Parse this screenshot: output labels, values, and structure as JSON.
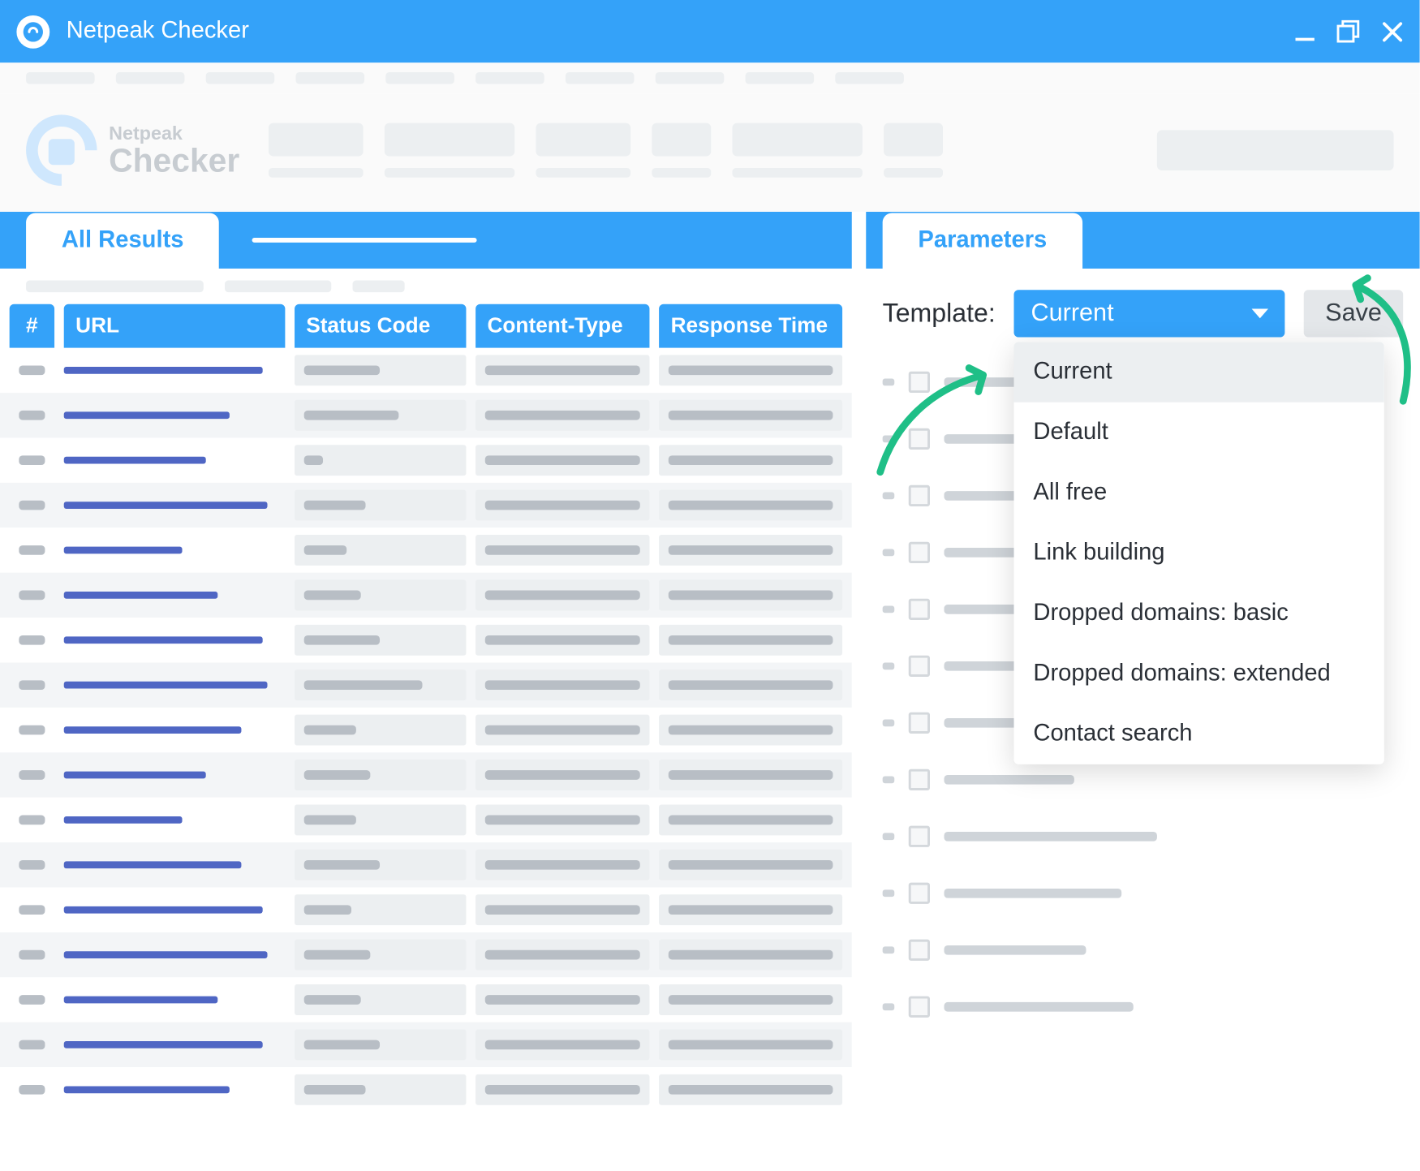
{
  "titlebar": {
    "app_name": "Netpeak Checker"
  },
  "logo": {
    "line1": "Netpeak",
    "line2": "Checker"
  },
  "tabs": {
    "all_results": "All Results",
    "parameters": "Parameters"
  },
  "table": {
    "headers": {
      "num": "#",
      "url": "URL",
      "status": "Status Code",
      "content_type": "Content-Type",
      "response_time": "Response Time"
    },
    "rows": [
      {
        "url_w": 168,
        "sc_w": 64
      },
      {
        "url_w": 140,
        "sc_w": 80
      },
      {
        "url_w": 120,
        "sc_w": 16
      },
      {
        "url_w": 172,
        "sc_w": 52
      },
      {
        "url_w": 100,
        "sc_w": 36
      },
      {
        "url_w": 130,
        "sc_w": 48
      },
      {
        "url_w": 168,
        "sc_w": 64
      },
      {
        "url_w": 172,
        "sc_w": 100
      },
      {
        "url_w": 150,
        "sc_w": 44
      },
      {
        "url_w": 120,
        "sc_w": 56
      },
      {
        "url_w": 100,
        "sc_w": 44
      },
      {
        "url_w": 150,
        "sc_w": 64
      },
      {
        "url_w": 168,
        "sc_w": 40
      },
      {
        "url_w": 172,
        "sc_w": 56
      },
      {
        "url_w": 130,
        "sc_w": 48
      },
      {
        "url_w": 168,
        "sc_w": 64
      },
      {
        "url_w": 140,
        "sc_w": 52
      }
    ]
  },
  "right": {
    "template_label": "Template:",
    "selected": "Current",
    "save": "Save",
    "options": [
      "Current",
      "Default",
      "All free",
      "Link building",
      "Dropped domains: basic",
      "Dropped domains: extended",
      "Contact search"
    ],
    "param_placeholder_widths": [
      150,
      130,
      90,
      170,
      200,
      140,
      160,
      110,
      180,
      150,
      120,
      160
    ]
  }
}
